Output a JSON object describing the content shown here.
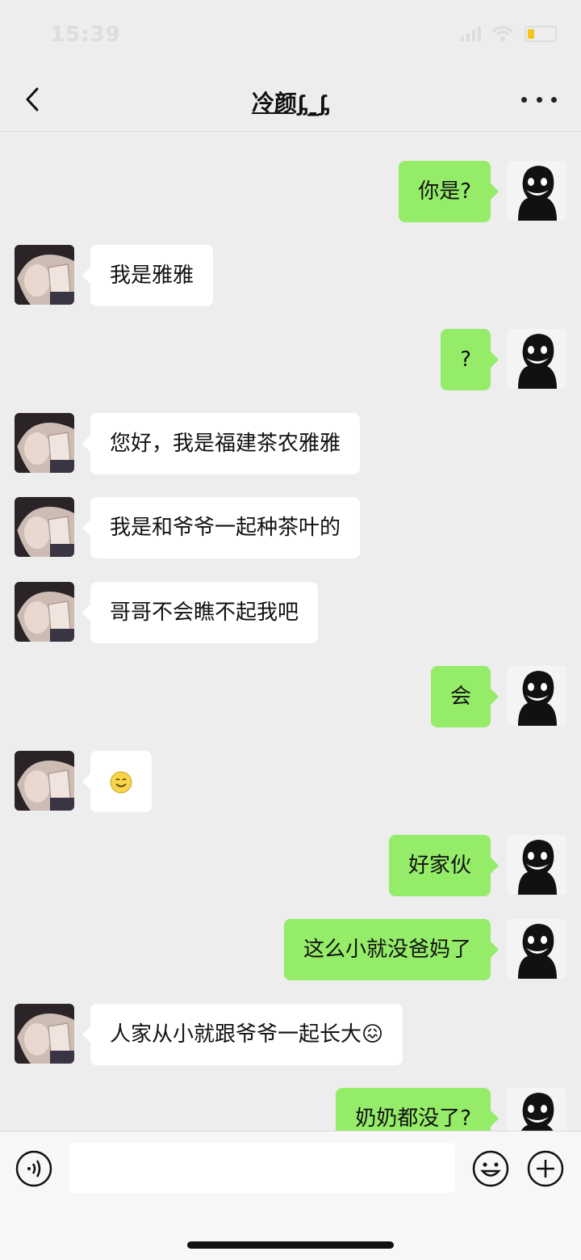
{
  "status_bar": {
    "time": "15:39",
    "battery_level": 0.25,
    "battery_color": "#f5c518"
  },
  "header": {
    "title": "冷颜ᶋ_ᶋ",
    "back_icon": "chevron-left-icon",
    "more_icon": "more-dots-icon"
  },
  "colors": {
    "background": "#ededed",
    "outgoing_bubble": "#95ec69",
    "incoming_bubble": "#ffffff"
  },
  "messages": [
    {
      "side": "right",
      "text": "你是?"
    },
    {
      "side": "left",
      "text": "我是雅雅"
    },
    {
      "side": "right",
      "text": "?"
    },
    {
      "side": "left",
      "text": "您好，我是福建茶农雅雅"
    },
    {
      "side": "left",
      "text": "我是和爷爷一起种茶叶的"
    },
    {
      "side": "left",
      "text": "哥哥不会瞧不起我吧"
    },
    {
      "side": "right",
      "text": "会"
    },
    {
      "side": "left",
      "text": "",
      "emoji": "smile-emoji"
    },
    {
      "side": "right",
      "text": "好家伙"
    },
    {
      "side": "right",
      "text": "这么小就没爸妈了"
    },
    {
      "side": "left",
      "text": "人家从小就跟爷爷一起长大😖"
    },
    {
      "side": "right",
      "text": "奶奶都没了?"
    }
  ],
  "input_bar": {
    "voice_icon": "voice-icon",
    "input_value": "",
    "emoji_icon": "emoji-icon",
    "plus_icon": "plus-icon"
  }
}
